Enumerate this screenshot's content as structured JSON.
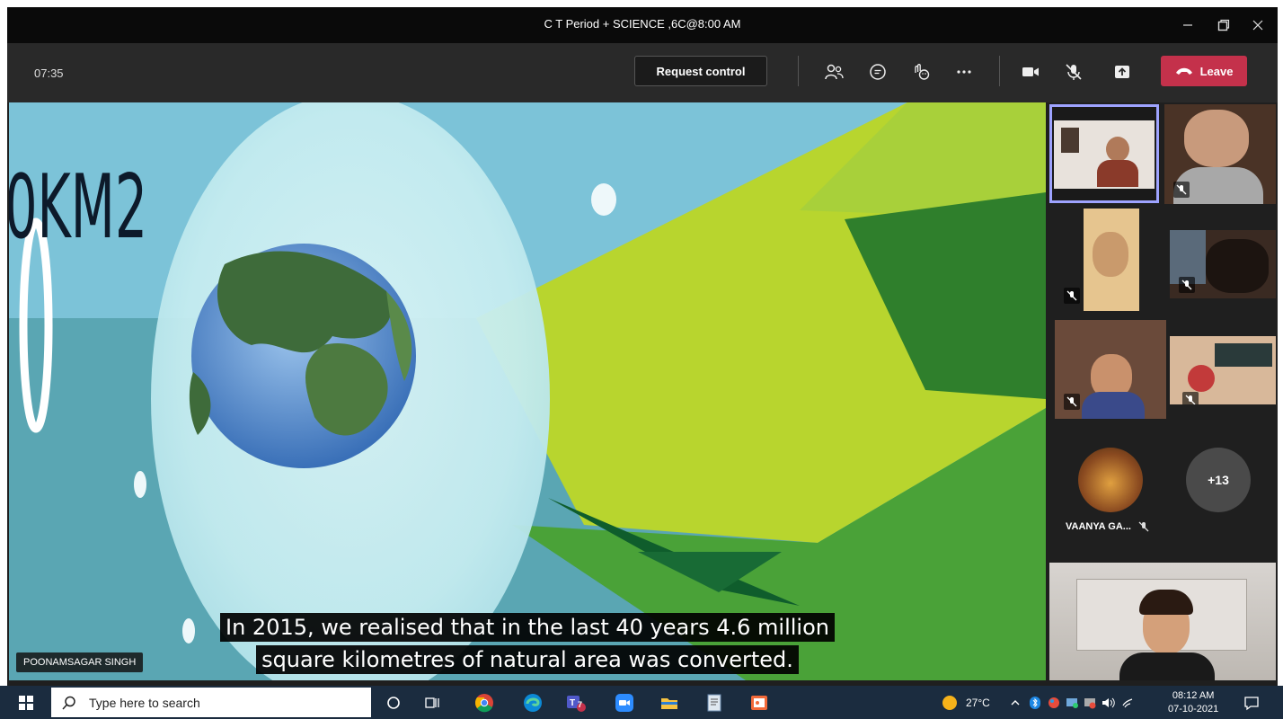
{
  "window": {
    "title": "C T Period + SCIENCE ,6C@8:00 AM"
  },
  "meeting": {
    "timer": "07:35",
    "request_control_label": "Request control",
    "leave_label": "Leave",
    "controls": [
      "people-icon",
      "chat-icon",
      "reactions-icon",
      "more-icon",
      "camera-icon",
      "mic-muted-icon",
      "share-icon"
    ]
  },
  "stage": {
    "slide_text": "0KM2",
    "caption_line1": "In 2015, we realised that in the last 40 years 4.6 million",
    "caption_line2": "square kilometres of natural area was converted.",
    "presenter_name": "POONAMSAGAR SINGH"
  },
  "participants": {
    "vaanya_name": "VAANYA GA...",
    "overflow_count": "+13"
  },
  "taskbar": {
    "search_placeholder": "Type here to search",
    "teams_badge": "7",
    "temperature": "27°C",
    "time": "08:12 AM",
    "date": "07-10-2021"
  },
  "colors": {
    "leave": "#c4314b",
    "active_tile_border": "#9ea3ff",
    "taskbar": "#1b2c3f"
  }
}
